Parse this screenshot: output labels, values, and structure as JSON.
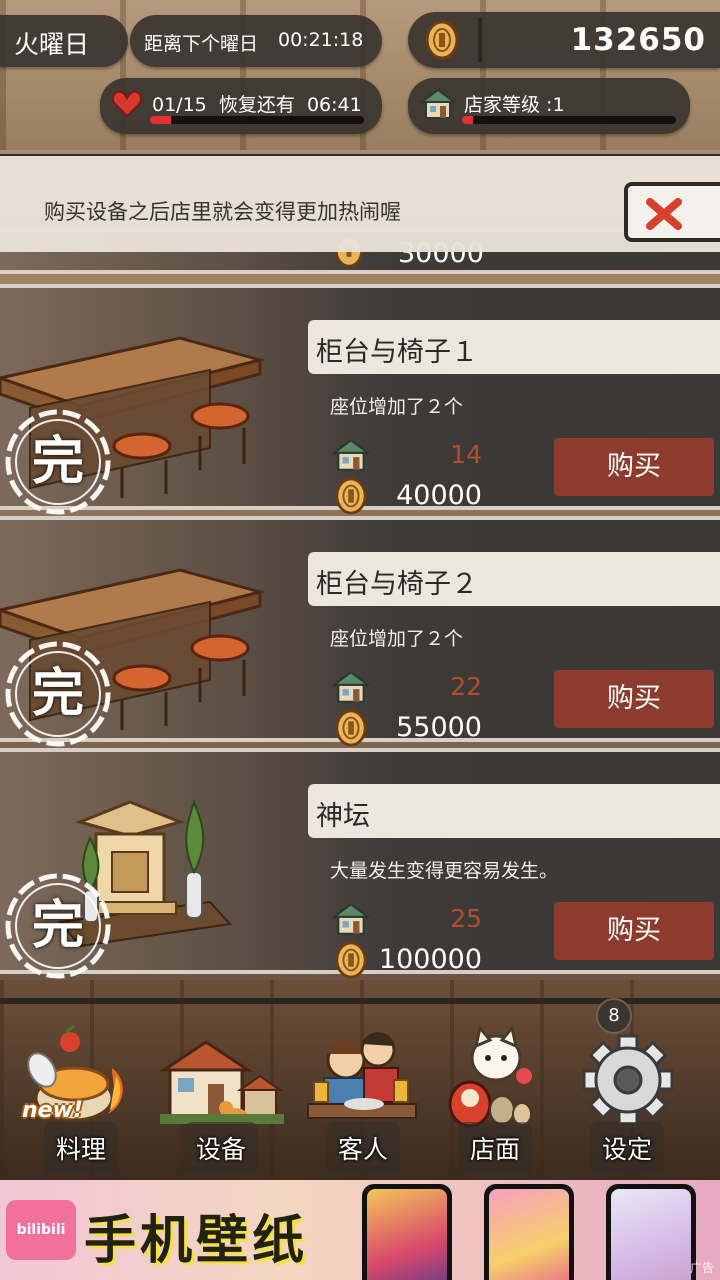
{
  "hud": {
    "day": "火曜日",
    "countdown_label": "距离下个曜日",
    "countdown_time": "00:21:18",
    "coins": "132650",
    "stamina": "01/15",
    "recover_label": "恢复还有",
    "recover_time": "06:41",
    "stamina_fill": 0.1,
    "shop_level": "店家等级 :1",
    "level_fill": 0.05
  },
  "banner": {
    "message": "购买设备之后店里就会变得更加热闹喔"
  },
  "partial_card": {
    "price": "30000"
  },
  "items": [
    {
      "name": "柜台与椅子１",
      "desc": "座位增加了２个",
      "level": "14",
      "price": "40000",
      "buy": "购买",
      "stamp": "完",
      "img": "counter"
    },
    {
      "name": "柜台与椅子２",
      "desc": "座位增加了２个",
      "level": "22",
      "price": "55000",
      "buy": "购买",
      "stamp": "完",
      "img": "counter"
    },
    {
      "name": "神坛",
      "desc": "大量发生变得更容易发生。",
      "level": "25",
      "price": "100000",
      "buy": "购买",
      "stamp": "完",
      "img": "shrine"
    }
  ],
  "nav": {
    "items": [
      {
        "label": "料理",
        "icon": "cooking-icon"
      },
      {
        "label": "设备",
        "icon": "equipment-icon"
      },
      {
        "label": "客人",
        "icon": "guests-icon"
      },
      {
        "label": "店面",
        "icon": "storefront-icon"
      },
      {
        "label": "设定",
        "icon": "gear-icon"
      }
    ],
    "new_tag": "new!",
    "settings_badge": "8"
  },
  "ad": {
    "logo": "bilibili",
    "title": "手机壁纸",
    "mark": "广告"
  },
  "colors": {
    "buy_button": "#8c3b2c",
    "level_text": "#b24e2a",
    "progress_fill": "#e3312f"
  }
}
